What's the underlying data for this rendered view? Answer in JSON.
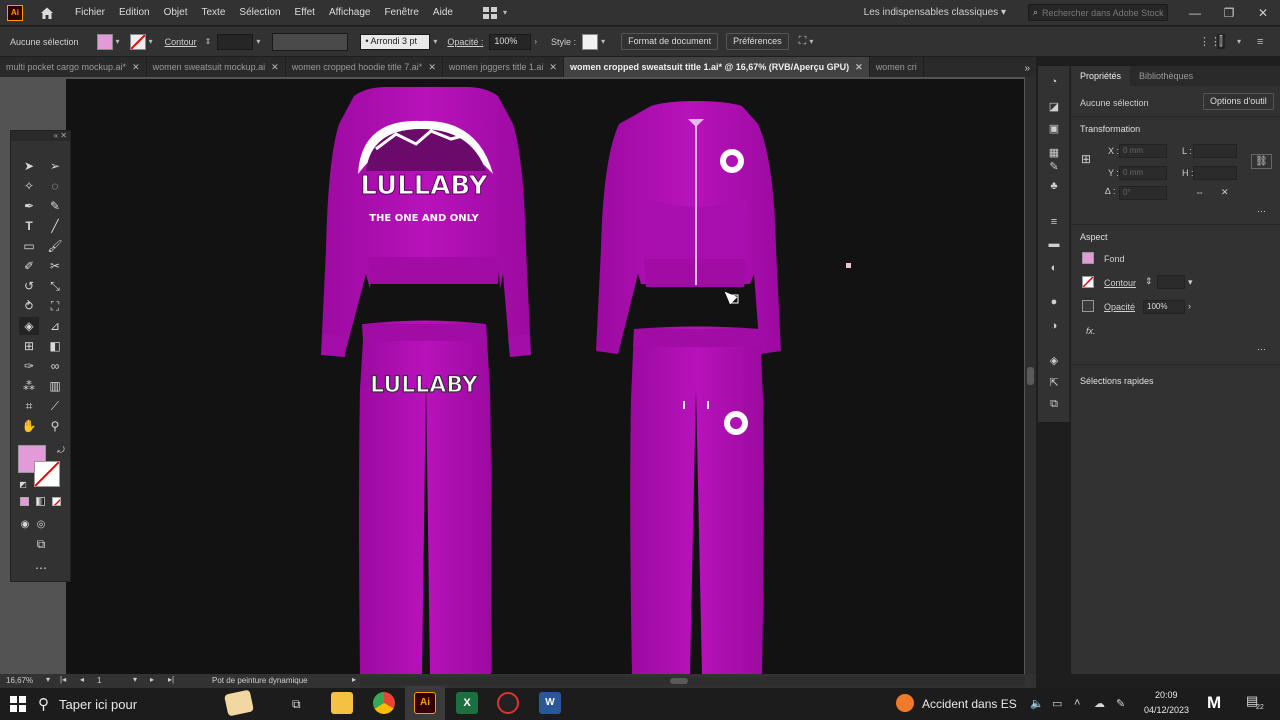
{
  "app": {
    "menus": [
      "Fichier",
      "Edition",
      "Objet",
      "Texte",
      "Sélection",
      "Effet",
      "Affichage",
      "Fenêtre",
      "Aide"
    ],
    "workspace": "Les indispensables classiques",
    "stock_search_placeholder": "Rechercher dans Adobe Stock",
    "logo_text": "Ai"
  },
  "controlbar": {
    "selection_label": "Aucune sélection",
    "stroke_label": "Contour",
    "brush_label": "Arrondi 3 pt",
    "opacity_label": "Opacité :",
    "opacity_value": "100%",
    "style_label": "Style :",
    "doc_format_button": "Format de document",
    "preferences_button": "Préférences"
  },
  "tabs": [
    {
      "label": "multi pocket cargo mockup.ai*",
      "active": false
    },
    {
      "label": "women sweatsuit mockup.ai",
      "active": false
    },
    {
      "label": "women cropped hoodie title 7.ai*",
      "active": false
    },
    {
      "label": "women joggers title 1.ai",
      "active": false
    },
    {
      "label": "women cropped sweatsuit title 1.ai* @ 16,67% (RVB/Aperçu GPU)",
      "active": true
    },
    {
      "label": "women cri",
      "active": false
    }
  ],
  "artwork": {
    "hoodie_back_brand": "LULLABY",
    "hoodie_back_tagline": "THE ONE AND ONLY",
    "jogger_front_brand": "LULLABY",
    "garment_color": "#b10fb4",
    "artboard_color": "#121212"
  },
  "properties_panel": {
    "tab_properties": "Propriétés",
    "tab_libraries": "Bibliothèques",
    "selection_text": "Aucune sélection",
    "tool_options_button": "Options d'outil",
    "transform_title": "Transformation",
    "x_label": "X :",
    "y_label": "Y :",
    "w_label": "L :",
    "h_label": "H :",
    "angle_label": "∆ :",
    "x_placeholder": "0 mm",
    "y_placeholder": "0 mm",
    "angle_placeholder": "0°",
    "aspect_title": "Aspect",
    "fill_label": "Fond",
    "stroke_label": "Contour",
    "opacity_label": "Opacité",
    "opacity_value": "100%",
    "fx_label": "fx.",
    "quick_actions_title": "Sélections rapides",
    "fill_color": "#e39ad8"
  },
  "statusbar": {
    "zoom": "16,67%",
    "artboard_number": "1",
    "tool_name": "Pot de peinture dynamique"
  },
  "taskbar": {
    "search_placeholder": "Taper ici pour",
    "news_text": "Accident dans ES",
    "time": "20:09",
    "date": "04/12/2023",
    "notifications_count": "22"
  }
}
